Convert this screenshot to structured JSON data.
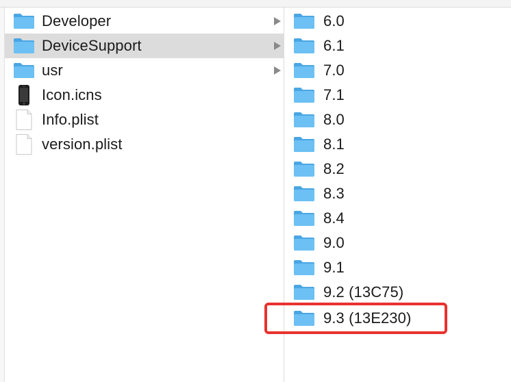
{
  "left_column": {
    "items": [
      {
        "label": "Developer",
        "icon": "folder-icon",
        "has_children": true
      },
      {
        "label": "DeviceSupport",
        "icon": "folder-icon",
        "has_children": true,
        "selected": true
      },
      {
        "label": "usr",
        "icon": "folder-icon",
        "has_children": true
      },
      {
        "label": "Icon.icns",
        "icon": "iphone-icon",
        "has_children": false
      },
      {
        "label": "Info.plist",
        "icon": "document-icon",
        "has_children": false
      },
      {
        "label": "version.plist",
        "icon": "document-icon",
        "has_children": false
      }
    ]
  },
  "right_column": {
    "items": [
      {
        "label": "6.0",
        "icon": "folder-icon"
      },
      {
        "label": "6.1",
        "icon": "folder-icon"
      },
      {
        "label": "7.0",
        "icon": "folder-icon"
      },
      {
        "label": "7.1",
        "icon": "folder-icon"
      },
      {
        "label": "8.0",
        "icon": "folder-icon"
      },
      {
        "label": "8.1",
        "icon": "folder-icon"
      },
      {
        "label": "8.2",
        "icon": "folder-icon"
      },
      {
        "label": "8.3",
        "icon": "folder-icon"
      },
      {
        "label": "8.4",
        "icon": "folder-icon"
      },
      {
        "label": "9.0",
        "icon": "folder-icon"
      },
      {
        "label": "9.1",
        "icon": "folder-icon"
      },
      {
        "label": "9.2 (13C75)",
        "icon": "folder-icon"
      },
      {
        "label": "9.3 (13E230)",
        "icon": "folder-icon",
        "annotated": true
      }
    ]
  },
  "colors": {
    "folder": "#5fb8f0",
    "folder_tab": "#4aa6e3",
    "selected_row": "#dcdcdc",
    "annotation": "#e8322f",
    "chevron": "#8a8a8a"
  }
}
